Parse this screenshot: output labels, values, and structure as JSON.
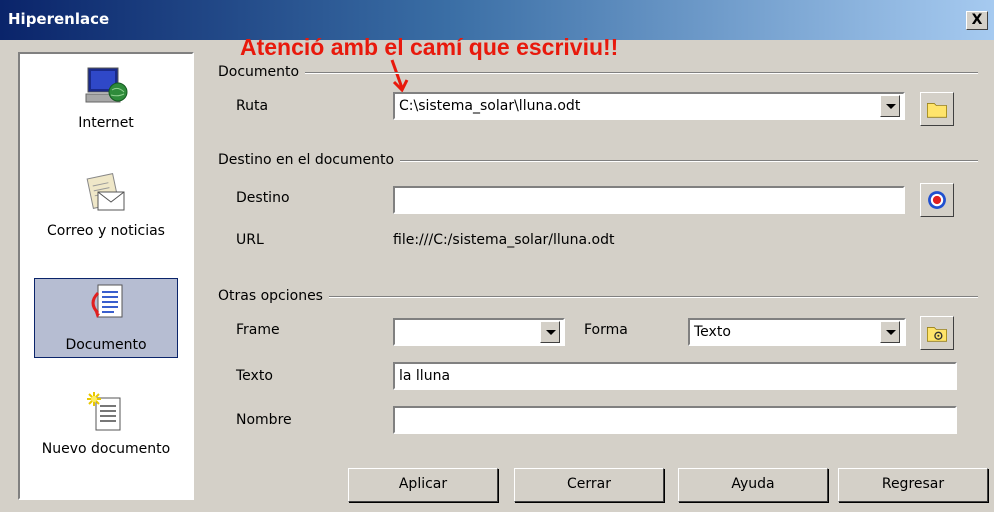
{
  "window": {
    "title": "Hiperenlace",
    "close_glyph": "X"
  },
  "annotation": "Atenció amb el camí que escriviu!!",
  "sidebar": {
    "items": [
      {
        "label": "Internet",
        "icon": "globe-computer-icon",
        "selected": false
      },
      {
        "label": "Correo y noticias",
        "icon": "mail-icon",
        "selected": false
      },
      {
        "label": "Documento",
        "icon": "document-link-icon",
        "selected": true
      },
      {
        "label": "Nuevo documento",
        "icon": "new-document-icon",
        "selected": false
      }
    ]
  },
  "documento": {
    "group_label": "Documento",
    "ruta_label": "Ruta",
    "ruta_value": "C:\\sistema_solar\\lluna.odt"
  },
  "destino_group": {
    "group_label": "Destino en el documento",
    "destino_label": "Destino",
    "destino_value": "",
    "url_label": "URL",
    "url_value": "file:///C:/sistema_solar/lluna.odt"
  },
  "otras": {
    "group_label": "Otras opciones",
    "frame_label": "Frame",
    "frame_value": "",
    "forma_label": "Forma",
    "forma_value": "Texto",
    "texto_label": "Texto",
    "texto_value": "la lluna",
    "nombre_label": "Nombre",
    "nombre_value": ""
  },
  "buttons": {
    "aplicar": "Aplicar",
    "cerrar": "Cerrar",
    "ayuda": "Ayuda",
    "regresar": "Regresar"
  },
  "colors": {
    "titlebar": "#0a246a",
    "annotation": "#e8190c",
    "selection": "#b6bdd2"
  }
}
